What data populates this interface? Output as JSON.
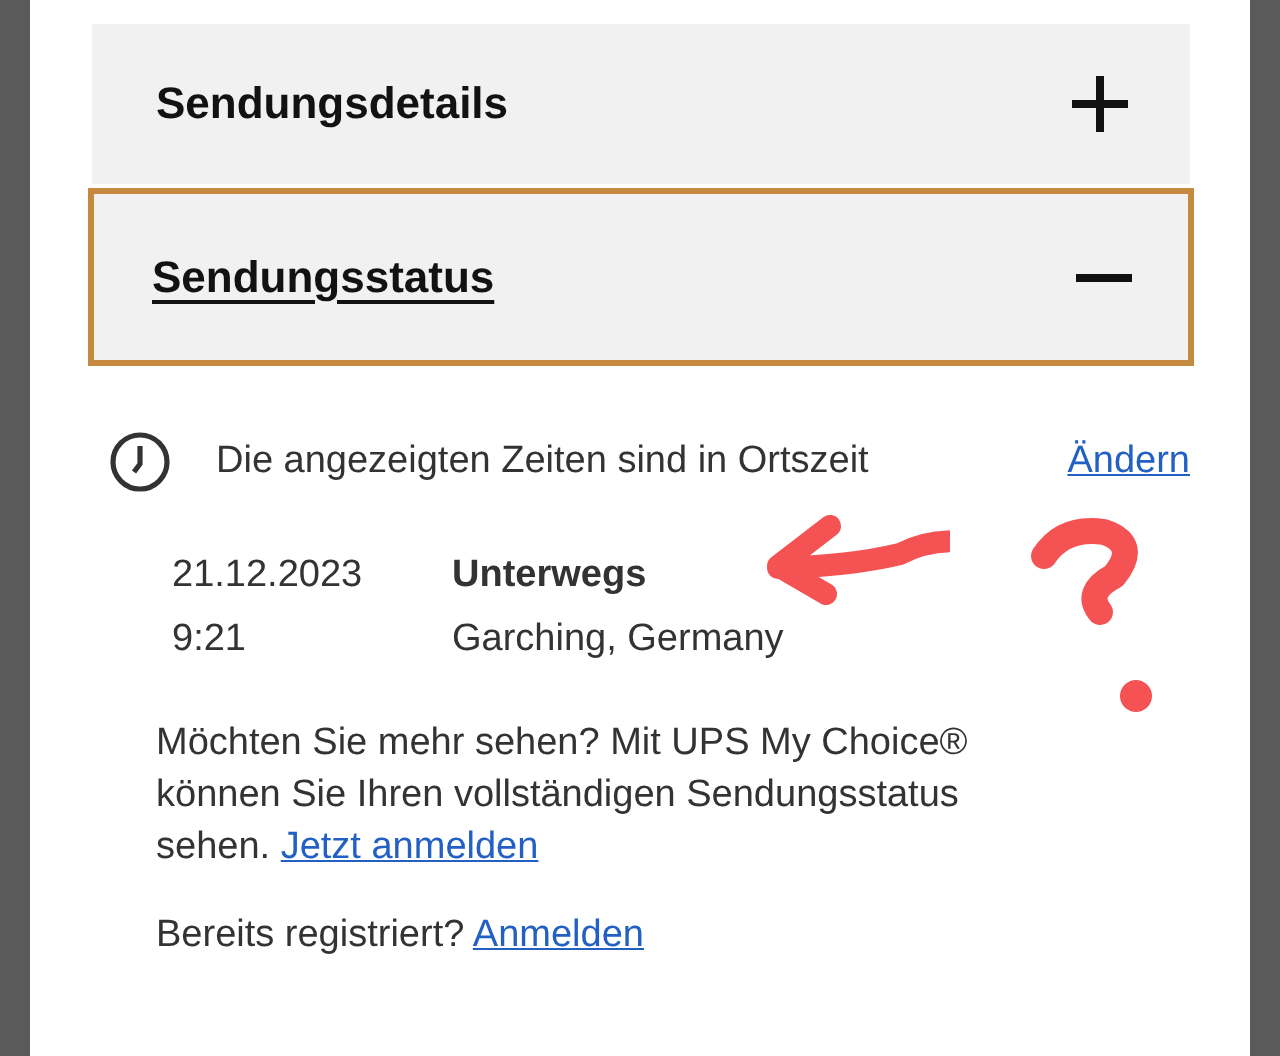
{
  "sections": [
    {
      "title": "Sendungsdetails",
      "expanded": false,
      "focused": false
    },
    {
      "title": "Sendungsstatus",
      "expanded": true,
      "focused": true
    }
  ],
  "timezone_note": {
    "text": "Die angezeigten Zeiten sind in Ortszeit",
    "link": "Ändern"
  },
  "events": [
    {
      "date": "21.12.2023",
      "time": "9:21",
      "status": "Unterwegs",
      "location": "Garching, Germany"
    }
  ],
  "upsell": {
    "text": "Möchten Sie mehr sehen? Mit UPS My Choice® können Sie Ihren vollständigen Sendungsstatus sehen.",
    "link": "Jetzt anmelden"
  },
  "login": {
    "text": "Bereits registriert?",
    "link": "Anmelden"
  }
}
